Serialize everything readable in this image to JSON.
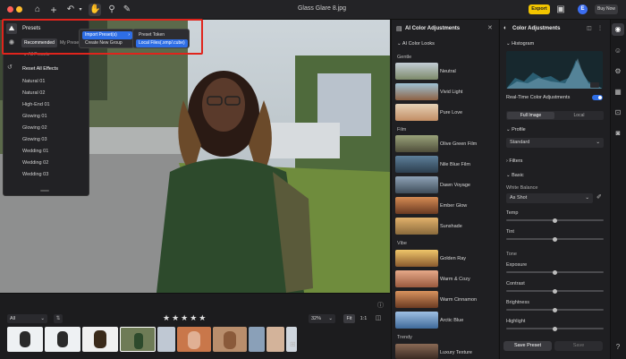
{
  "window": {
    "title": "Glass Glare 8.jpg"
  },
  "topbar": {
    "export_label": "Export",
    "buynow_label": "Buy Now",
    "avatar_letter": "E"
  },
  "presets_panel": {
    "title": "Presets",
    "tabs": [
      "Recommended",
      "My Presets"
    ],
    "all_presets": "All Presets",
    "reset": "Reset All Effects",
    "items": [
      "Natural 01",
      "Natural 02",
      "High-End 01",
      "Glowing 01",
      "Glowing 02",
      "Glowing 03",
      "Wedding 01",
      "Wedding 02",
      "Wedding 03"
    ]
  },
  "import_menu": {
    "items": [
      "Import Preset(s)",
      "Create New Group"
    ]
  },
  "import_submenu": {
    "items": [
      "Preset Token",
      "Local Files(.xmp/.cube)"
    ]
  },
  "bottombar": {
    "filter_value": "All",
    "zoom": "32%",
    "fit": "Fit",
    "one_to_one": "1:1",
    "rating_stars": 5
  },
  "ai_panel": {
    "title": "AI Color Adjustments",
    "subtitle": "AI Color Looks",
    "sections": {
      "gentle": "Gentle",
      "film": "Film",
      "vibe": "Vibe",
      "trendy": "Trendy"
    },
    "looks": [
      "Neutral",
      "Vivid Light",
      "Pure Love",
      "Olive Green Film",
      "Nile Blue Film",
      "Dawn Voyage",
      "Ember Glow",
      "Sunshade",
      "Golden Ray",
      "Warm & Cozy",
      "Warm Cinnamon",
      "Arctic Blue",
      "Luxury Texture"
    ]
  },
  "right_panel": {
    "title": "Color Adjustments",
    "histogram": "Histogram",
    "realtime": "Real-Time Color Adjustments",
    "tabs": [
      "Full Image",
      "Local"
    ],
    "profile_label": "Profile",
    "profile_value": "Standard",
    "filters": "Filters",
    "basic": "Basic",
    "white_balance": "White Balance",
    "wb_value": "As Shot",
    "temp": "Temp",
    "tint": "Tint",
    "tone": "Tone",
    "exposure": "Exposure",
    "contrast": "Contrast",
    "brightness": "Brightness",
    "highlight": "Highlight",
    "save_preset": "Save Preset",
    "save": "Save"
  },
  "colors": {
    "accent": "#2e6ee6",
    "export": "#f2c500",
    "highlight_box": "#e0241c"
  }
}
